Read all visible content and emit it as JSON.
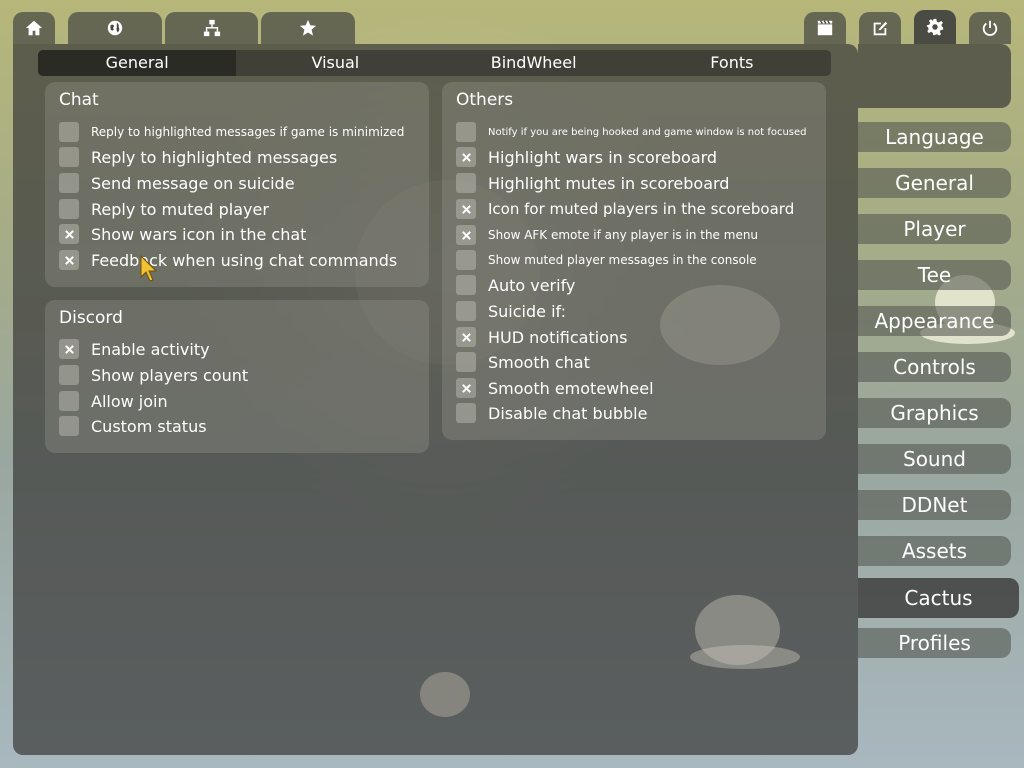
{
  "top_tabs": {
    "left": [
      {
        "icon": "home-icon"
      },
      {
        "icon": "globe-icon"
      },
      {
        "icon": "network-icon"
      },
      {
        "icon": "star-icon"
      }
    ],
    "right": [
      {
        "icon": "demo-clapper-icon"
      },
      {
        "icon": "edit-icon"
      },
      {
        "icon": "gear-icon"
      },
      {
        "icon": "power-icon"
      }
    ]
  },
  "subtabs": [
    "General",
    "Visual",
    "BindWheel",
    "Fonts"
  ],
  "chat": {
    "title": "Chat",
    "items": [
      {
        "label": "Reply to highlighted messages if game is minimized",
        "checked": false
      },
      {
        "label": "Reply to highlighted messages",
        "checked": false
      },
      {
        "label": "Send message on suicide",
        "checked": false
      },
      {
        "label": "Reply to muted player",
        "checked": false
      },
      {
        "label": "Show wars icon in the chat",
        "checked": true
      },
      {
        "label": "Feedback when using chat commands",
        "checked": true
      }
    ]
  },
  "discord": {
    "title": "Discord",
    "items": [
      {
        "label": "Enable activity",
        "checked": true
      },
      {
        "label": "Show players count",
        "checked": false
      },
      {
        "label": "Allow join",
        "checked": false
      },
      {
        "label": "Custom status",
        "checked": false
      }
    ]
  },
  "others": {
    "title": "Others",
    "items": [
      {
        "label": "Notify if you are being hooked and game window is not focused",
        "checked": false
      },
      {
        "label": "Highlight wars in scoreboard",
        "checked": true
      },
      {
        "label": "Highlight mutes in scoreboard",
        "checked": false
      },
      {
        "label": "Icon for muted players in the scoreboard",
        "checked": true
      },
      {
        "label": "Show AFK emote if any player is in the menu",
        "checked": true
      },
      {
        "label": "Show muted player messages in the console",
        "checked": false
      },
      {
        "label": "Auto verify",
        "checked": false
      },
      {
        "label": "Suicide if:",
        "checked": false
      },
      {
        "label": "HUD notifications",
        "checked": true
      },
      {
        "label": "Smooth chat",
        "checked": false
      },
      {
        "label": "Smooth emotewheel",
        "checked": true
      },
      {
        "label": "Disable chat bubble",
        "checked": false
      }
    ]
  },
  "side_menu": [
    "Language",
    "General",
    "Player",
    "Tee",
    "Appearance",
    "Controls",
    "Graphics",
    "Sound",
    "DDNet",
    "Assets",
    "Cactus",
    "Profiles"
  ],
  "colors": {
    "panel": "#3c3c3a",
    "accent": "#ffffff",
    "cursor": "#f2c230"
  }
}
